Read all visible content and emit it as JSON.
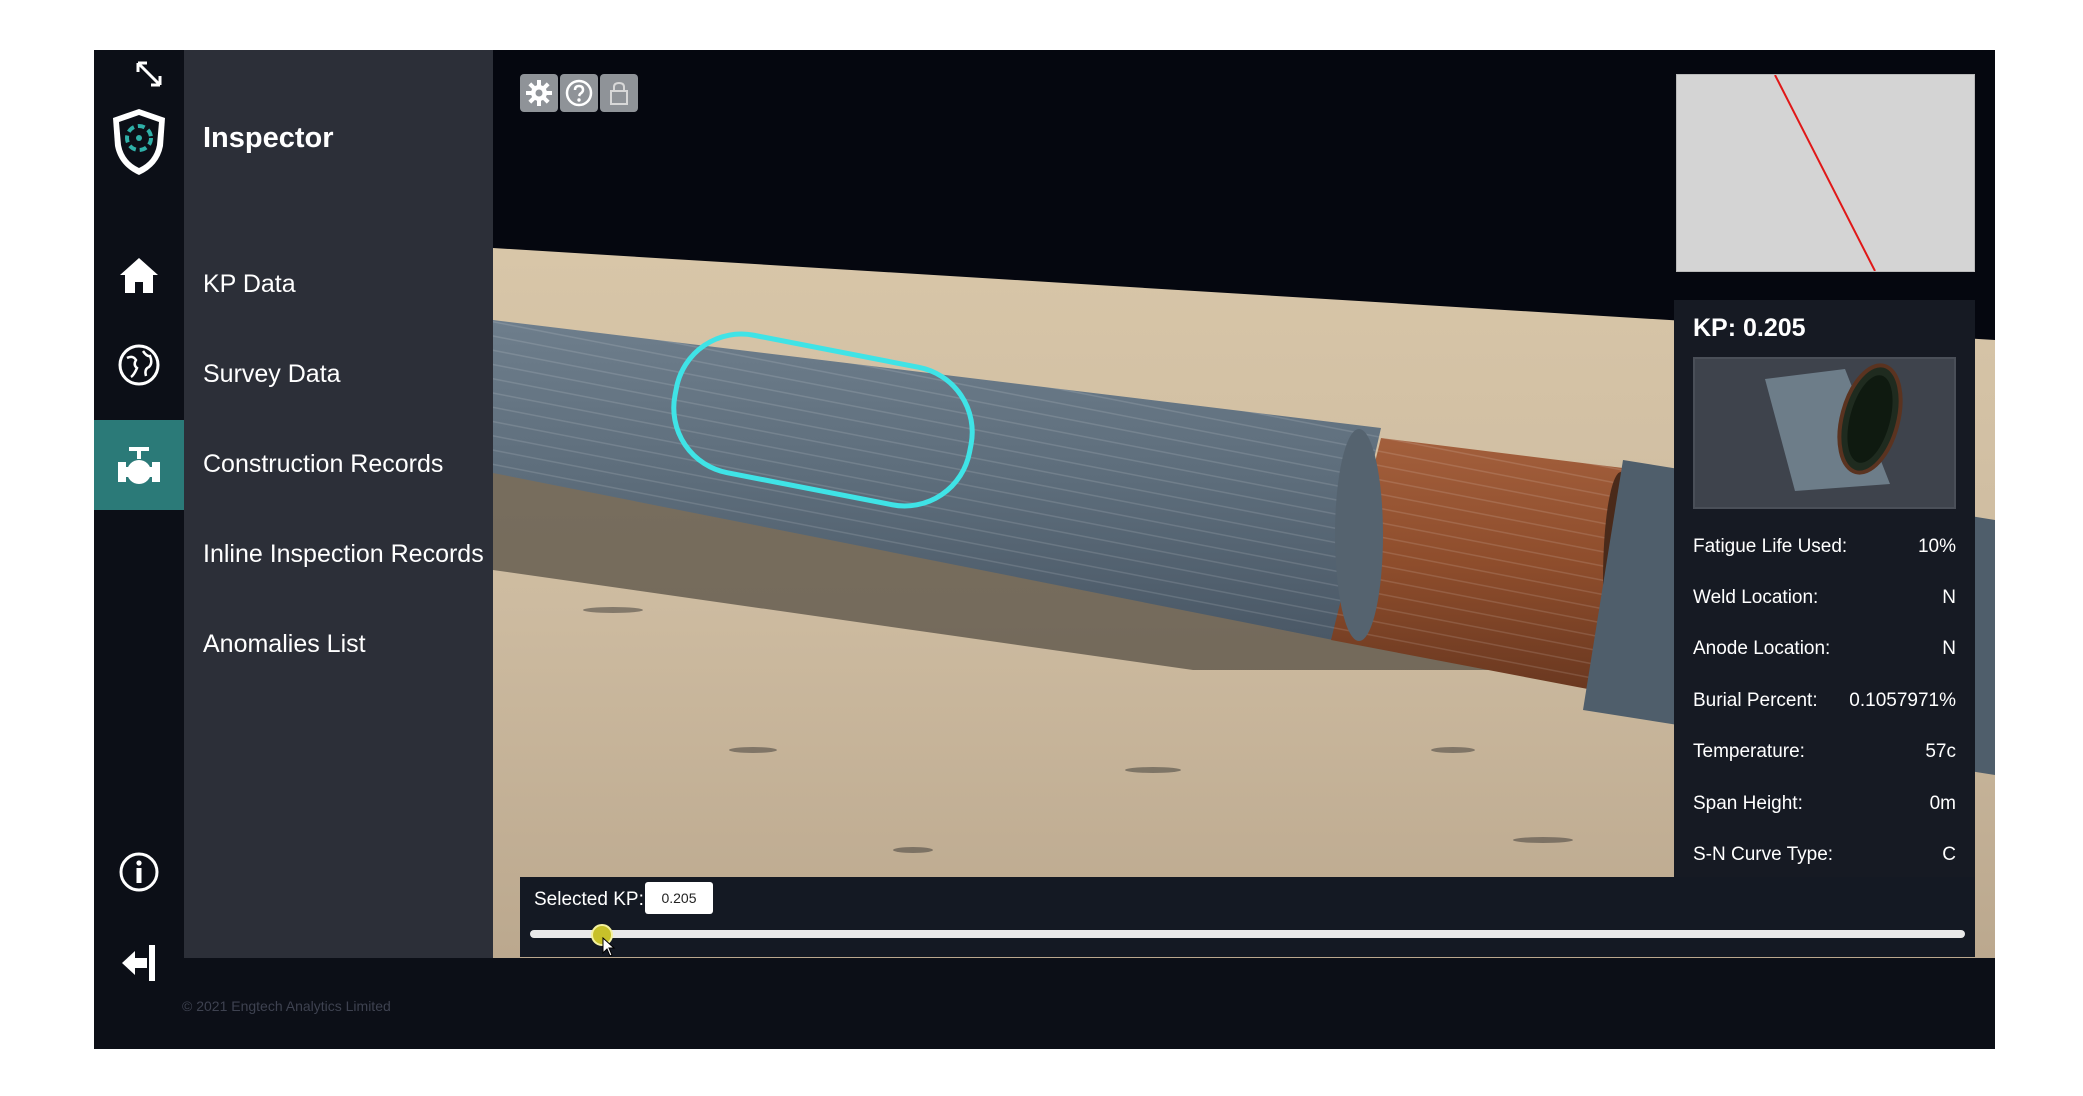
{
  "app": {
    "title": "Inspector"
  },
  "rail": {
    "icons": [
      "expand-icon",
      "shield-logo-icon",
      "home-icon",
      "globe-icon",
      "valve-icon",
      "info-icon",
      "logout-icon"
    ]
  },
  "nav": {
    "items": [
      {
        "label": "KP Data"
      },
      {
        "label": "Survey Data"
      },
      {
        "label": "Construction Records"
      },
      {
        "label": "Inline Inspection Records"
      },
      {
        "label": "Anomalies List"
      }
    ],
    "active_icon": "valve-icon"
  },
  "toolbar": {
    "icons": [
      "gear-icon",
      "help-icon",
      "lock-icon"
    ]
  },
  "kp_panel": {
    "title": "KP: 0.205",
    "rows": [
      {
        "label": "Fatigue Life Used:",
        "value": "10%"
      },
      {
        "label": "Weld Location:",
        "value": "N"
      },
      {
        "label": "Anode Location:",
        "value": "N"
      },
      {
        "label": "Burial Percent:",
        "value": "0.1057971%"
      },
      {
        "label": "Temperature:",
        "value": "57c"
      },
      {
        "label": "Span Height:",
        "value": "0m"
      },
      {
        "label": "S-N Curve Type:",
        "value": "C"
      }
    ]
  },
  "kp_selector": {
    "label": "Selected KP:",
    "value": "0.205",
    "slider_fraction": 0.05
  },
  "footer": {
    "copyright": "© 2021 Engtech Analytics Limited"
  },
  "colors": {
    "accent": "#2b7a78",
    "highlight": "#3fe3e6",
    "minimap_line": "#e01818",
    "slider_handle": "#c8c12a"
  }
}
